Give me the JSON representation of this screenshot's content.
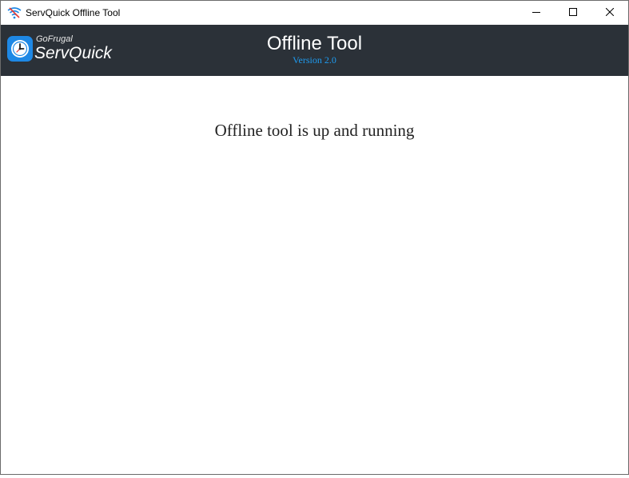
{
  "window": {
    "title": "ServQuick Offline Tool",
    "controls": {
      "minimize": "minimize-icon",
      "maximize": "maximize-icon",
      "close": "close-icon"
    }
  },
  "header": {
    "logo": {
      "brand": "GoFrugal",
      "product": "ServQuick",
      "icon": "clock-icon",
      "badge_color": "#1e88e5"
    },
    "title": "Offline Tool",
    "version": "Version 2.0",
    "background_color": "#2b3138",
    "version_color": "#1e9bf0"
  },
  "main": {
    "status_message": "Offline tool is up and running"
  }
}
